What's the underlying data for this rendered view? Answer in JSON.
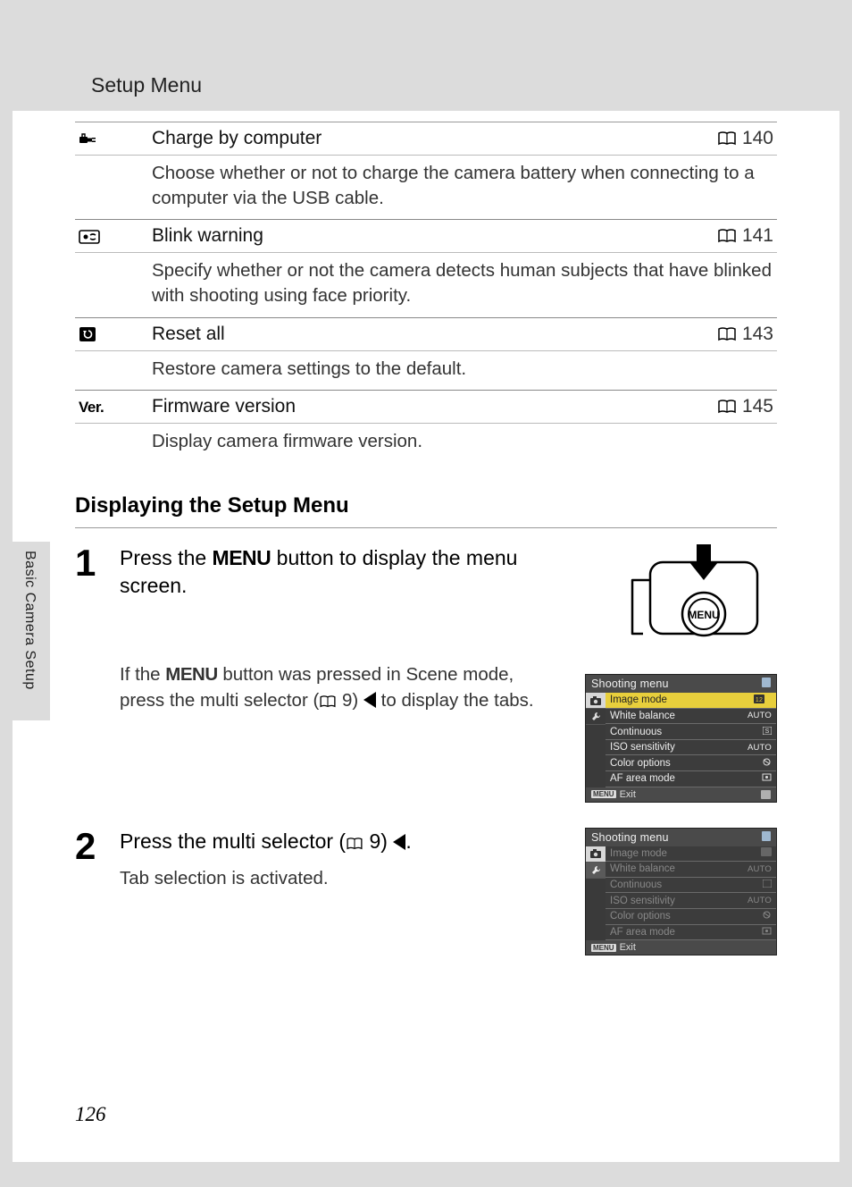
{
  "header": {
    "title": "Setup Menu"
  },
  "sidebar": {
    "label": "Basic Camera Setup"
  },
  "page_number": "126",
  "menu_items": [
    {
      "icon": "plug-icon",
      "label": "Charge by computer",
      "page": "140",
      "desc": "Choose whether or not to charge the camera battery when connecting to a computer via the USB cable."
    },
    {
      "icon": "blink-icon",
      "label": "Blink warning",
      "page": "141",
      "desc": "Specify whether or not the camera detects human subjects that have blinked with shooting using face priority."
    },
    {
      "icon": "reset-icon",
      "label": "Reset all",
      "page": "143",
      "desc": "Restore camera settings to the default."
    },
    {
      "icon": "ver-icon",
      "label": "Firmware version",
      "page": "145",
      "desc": "Display camera firmware version."
    }
  ],
  "section_heading": "Displaying the Setup Menu",
  "steps": {
    "one": {
      "num": "1",
      "text_pre": "Press the ",
      "menu_word": "MENU",
      "text_post": " button to display the menu screen.",
      "sub_pre": "If the ",
      "sub_mid": " button was pressed in Scene mode, press the multi selector (",
      "sub_pageref": "9",
      "sub_post": ") ",
      "sub_end": " to display the tabs."
    },
    "two": {
      "num": "2",
      "text_pre": "Press the multi selector (",
      "pageref": "9",
      "text_post": ") ",
      "text_end": ".",
      "sub": "Tab selection is activated."
    }
  },
  "diagram": {
    "button_label": "MENU"
  },
  "lcd1": {
    "title": "Shooting menu",
    "items": [
      {
        "label": "Image mode",
        "val": "",
        "hl": true
      },
      {
        "label": "White balance",
        "val": "AUTO",
        "hl": false
      },
      {
        "label": "Continuous",
        "val": "",
        "hl": false
      },
      {
        "label": "ISO sensitivity",
        "val": "AUTO",
        "hl": false
      },
      {
        "label": "Color options",
        "val": "",
        "hl": false
      },
      {
        "label": "AF area mode",
        "val": "",
        "hl": false
      }
    ],
    "exit": "Exit",
    "tab_active_index": 0
  },
  "lcd2": {
    "title": "Shooting menu",
    "items": [
      {
        "label": "Image mode",
        "val": "",
        "dim": true
      },
      {
        "label": "White balance",
        "val": "AUTO",
        "dim": true
      },
      {
        "label": "Continuous",
        "val": "",
        "dim": true
      },
      {
        "label": "ISO sensitivity",
        "val": "AUTO",
        "dim": true
      },
      {
        "label": "Color options",
        "val": "",
        "dim": true
      },
      {
        "label": "AF area mode",
        "val": "",
        "dim": true
      }
    ],
    "exit": "Exit",
    "tab_active_index": 0
  },
  "ver_text": "Ver."
}
